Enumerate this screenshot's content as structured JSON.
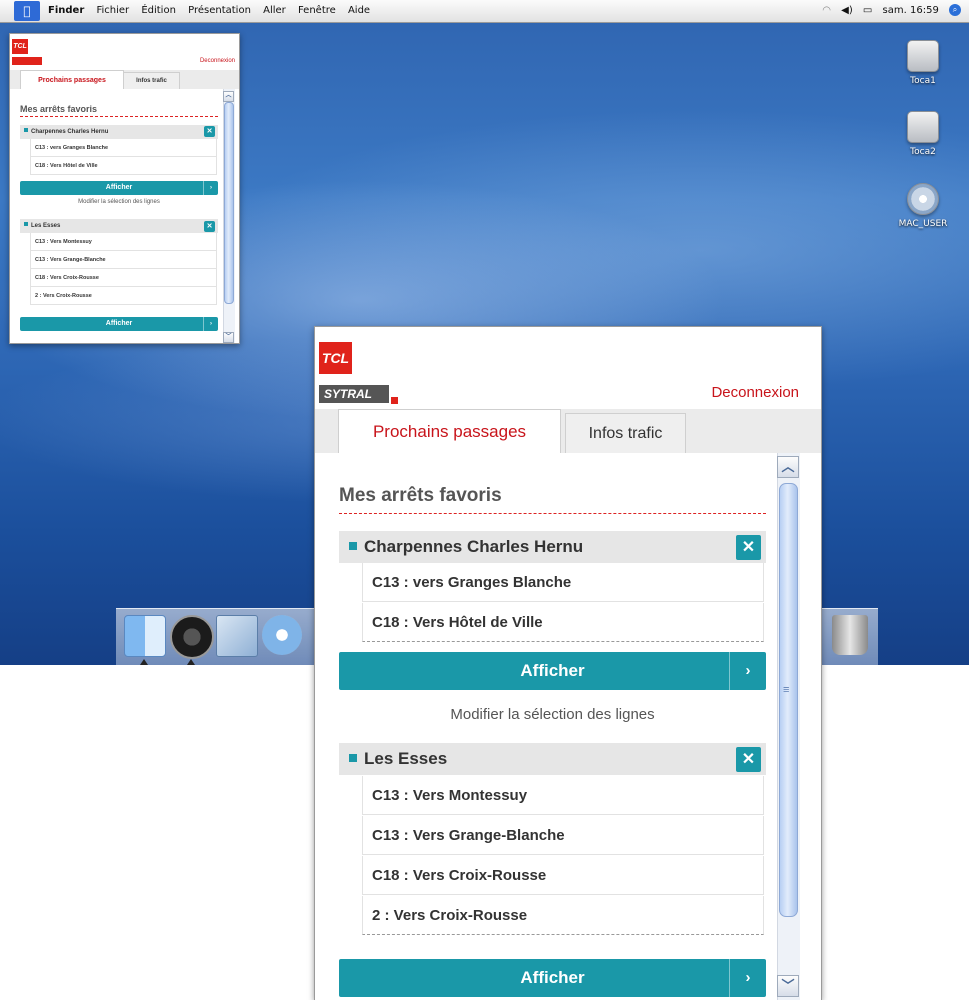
{
  "menubar": {
    "apple_glyph": "",
    "items": [
      "Finder",
      "Fichier",
      "Édition",
      "Présentation",
      "Aller",
      "Fenêtre",
      "Aide"
    ],
    "clock": "sam. 16:59"
  },
  "desktop_icons": [
    {
      "label": "Toca1",
      "icon": "hard-drive-icon"
    },
    {
      "label": "Toca2",
      "icon": "hard-drive-icon"
    },
    {
      "label": "MAC_USER",
      "icon": "cd-disc-icon"
    }
  ],
  "dock_icons": [
    "finder-icon",
    "dashboard-icon",
    "mail-icon",
    "safari-icon",
    "trash-icon"
  ],
  "widget": {
    "logo_tcl": "TCL",
    "logo_sytral": "SYTRAL",
    "logout": "Deconnexion",
    "tabs": [
      {
        "label": "Prochains passages",
        "active": true
      },
      {
        "label": "Infos trafic",
        "active": false
      }
    ],
    "section_title": "Mes arrêts favoris",
    "stops": [
      {
        "name": "Charpennes Charles Hernu",
        "lines": [
          "C13 : vers Granges Blanche",
          "C18 : Vers Hôtel de Ville"
        ],
        "show_label": "Afficher"
      },
      {
        "name": "Les Esses",
        "lines": [
          "C13 : Vers Montessuy",
          "C13 : Vers Grange-Blanche",
          "C18 : Vers Croix-Rousse",
          "2 : Vers Croix-Rousse"
        ],
        "show_label": "Afficher"
      }
    ],
    "modify_label": "Modifier la sélection des lignes",
    "remove_glyph": "✕",
    "chevron_glyph": "›",
    "scroll_up_glyph": "︿",
    "scroll_down_glyph": "﹀",
    "thumb_grip": "≡"
  },
  "colors": {
    "accent": "#1a98a8",
    "brand_red": "#e0231b",
    "link_red": "#c8141b"
  }
}
